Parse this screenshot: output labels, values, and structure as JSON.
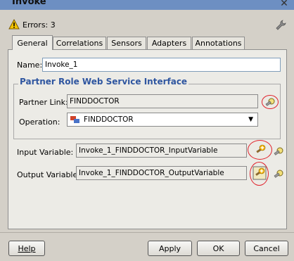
{
  "window": {
    "title": "Invoke",
    "close_glyph": "✕"
  },
  "errors": {
    "text": "Errors: 3"
  },
  "tabs": [
    {
      "label": "General"
    },
    {
      "label": "Correlations"
    },
    {
      "label": "Sensors"
    },
    {
      "label": "Adapters"
    },
    {
      "label": "Annotations"
    }
  ],
  "name": {
    "label": "Name:",
    "value": "Invoke_1"
  },
  "interface_group": {
    "title": "Partner Role Web Service Interface"
  },
  "partner_link": {
    "label": "Partner Link:",
    "value": "FINDDOCTOR"
  },
  "operation": {
    "label": "Operation:",
    "value": "FINDDOCTOR"
  },
  "input_variable": {
    "label": "Input Variable:",
    "value": "Invoke_1_FINDDOCTOR_InputVariable"
  },
  "output_variable": {
    "label": "Output Variable:",
    "value": "Invoke_1_FINDDOCTOR_OutputVariable"
  },
  "buttons": {
    "help": "Help",
    "apply": "Apply",
    "ok": "OK",
    "cancel": "Cancel"
  },
  "colors": {
    "accent_title": "#2f56a0",
    "annotation_red": "#e0202a",
    "dialog_bg": "#d4d0c8"
  }
}
